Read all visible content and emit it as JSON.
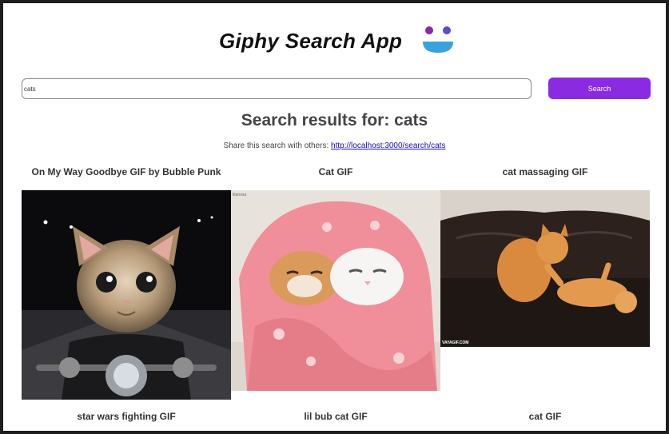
{
  "app": {
    "title": "Giphy Search App",
    "logo_icon": "smiley-face-icon"
  },
  "search": {
    "value": "cats",
    "button_label": "Search"
  },
  "results": {
    "heading": "Search results for: cats",
    "share_prefix": "Share this search with others:",
    "share_link": "http://localhost:3000/search/cats"
  },
  "gifs": [
    {
      "title": "On My Way Goodbye GIF by Bubble Punk",
      "image": "kitten-riding-motorcycle"
    },
    {
      "title": "Cat GIF",
      "image": "two-cats-in-pink-blanket",
      "badge": "litanosa"
    },
    {
      "title": "cat massaging GIF",
      "image": "cat-massaging-cat-on-sofa",
      "watermark": "VAYAGIF.COM"
    },
    {
      "title": "star wars fighting GIF"
    },
    {
      "title": "lil bub cat GIF"
    },
    {
      "title": "cat GIF"
    }
  ],
  "colors": {
    "accent": "#8a2be2",
    "logo_left_eye": "#8e24aa",
    "logo_right_eye": "#5c4bc4",
    "logo_mouth": "#3aa0e0"
  }
}
